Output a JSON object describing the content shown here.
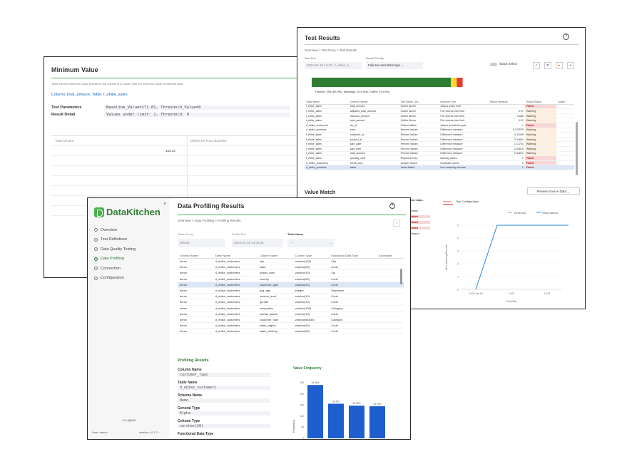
{
  "minimum_value": {
    "title": "Minimum Value",
    "description": "Tests that the minimum value present in the column is no lower than the minimum value in baseline data",
    "column_info": "Column: total_amount, Table: f_ebike_sales",
    "params_label": "Test Parameters",
    "params_value": "Baseline_Value=171.81, Threshold_Value=0",
    "result_label": "Result Detail",
    "result_value": "Values under limit: 1, Threshold: 0",
    "col1_header": "Total Amount",
    "col2_header": "Difference From Baseline",
    "cell_value": "153.13"
  },
  "test_results": {
    "title": "Test Results",
    "help": "?",
    "breadcrumb": "Overview > Test Runs > Test Results",
    "test_run_label": "Test Run",
    "test_run_value": "2024-01-15 14:10 - f_ebike_s...",
    "priority_label": "Result Priority",
    "priority_value": "Failures and Warnings",
    "stack_label": "Stack Select",
    "tools": [
      "✓",
      "✕",
      "▸",
      "+"
    ],
    "summary": "Passed: 209 (92.0%), Warnings: 9 (3.9%), Failed: 9 (3.9%)",
    "bar": {
      "passed_pct": 92.0,
      "warnings_pct": 3.9,
      "failed_pct": 3.9,
      "passed_color": "#2e7d32",
      "warning_color": "#fdd835",
      "failed_color": "#e53935"
    },
    "headers": [
      "Table Name",
      "Column Names",
      "Test Name / De...",
      "Measure Unit",
      "Result Measure",
      "Result Status",
      "Action"
    ],
    "rows": [
      [
        "f_ebike_sales",
        "total_amount",
        "Outlier Above",
        "Values under limit",
        "",
        "Failed",
        ""
      ],
      [
        "f_ebike_sales",
        "adjusted_total_amount",
        "Outlier Above",
        "Pct records over limit",
        "0.97",
        "Warning",
        ""
      ],
      [
        "f_ebike_sales",
        "discount_amount",
        "Outlier Above",
        "Pct records over limit",
        "0.886",
        "Warning",
        ""
      ],
      [
        "f_ebike_sales",
        "total_amount",
        "Outlier Above",
        "Pct records over limit",
        "0.97",
        "Warning",
        ""
      ],
      [
        "d_ebike_customers",
        "zip_id",
        "Pattern Match",
        "Values unmatched pat",
        "1",
        "Failed",
        ""
      ],
      [
        "d_ebike_products",
        "price",
        "Percent Values",
        "Difference measure",
        "0.123575",
        "Warning",
        ""
      ],
      [
        "f_ebike_sales",
        "customer_id",
        "Percent Values",
        "Difference measure",
        "0.11089",
        "Warning",
        ""
      ],
      [
        "f_ebike_sales",
        "product_id",
        "Percent Values",
        "Difference measure",
        "0.34844",
        "Warning",
        ""
      ],
      [
        "f_ebike_sales",
        "sale_date",
        "Percent Values",
        "Difference measure",
        "1.13743",
        "Warning",
        ""
      ],
      [
        "f_ebike_sales",
        "sale_time",
        "Percent Values",
        "Difference measure",
        "0.34816",
        "Warning",
        ""
      ],
      [
        "f_ebike_sales",
        "total_amount",
        "Percent Values",
        "Difference measure",
        "0.34871",
        "Warning",
        ""
      ],
      [
        "f_ebike_sales",
        "quantity_sold",
        "Required Entry",
        "Missing values",
        "1",
        "Failed",
        ""
      ],
      [
        "d_ebike_customers",
        "credit_card",
        "Unique Values",
        "Duplicate values",
        "0",
        "Failed",
        ""
      ],
      [
        "d_ebike_products",
        "sales",
        "Value Match",
        "Non-matching records",
        "1",
        "Failed",
        ""
      ]
    ],
    "selected_row": 13,
    "value_match_title": "Value Match",
    "review_button": "Review Source Data",
    "partial_text": "ource data...",
    "tab_history": "History",
    "tab_config": "Test Configuration",
    "mini_statuses": [
      "Status",
      "Failed",
      "Failed",
      "Failed",
      "Passed"
    ],
    "chart_data": {
      "type": "line",
      "series": [
        {
          "name": "Threshold",
          "color": "#90a4ae"
        },
        {
          "name": "Observations",
          "color": "#1e88e5"
        }
      ],
      "x": [
        "13:25 Jan 15",
        "14:00",
        "14:30"
      ],
      "y_ticks": [
        "0",
        "1",
        "2",
        "3",
        "4",
        "5"
      ],
      "points": [
        [
          0,
          0
        ],
        [
          0.6,
          5
        ],
        [
          2.6,
          5
        ]
      ],
      "ylabel": "Non-matching Records",
      "xlabel": "Test Date"
    }
  },
  "profiling": {
    "logo": "DataKitchen",
    "close": "×",
    "nav": [
      "Overview",
      "Test Definitions",
      "Data Quality Testing",
      "Data Profiling",
      "Connection",
      "Configuration"
    ],
    "nav_active": 3,
    "logout": "Logout",
    "user": "User: admin",
    "version": "version: v2.1.2 ~",
    "title": "Data Profiling Results",
    "help": "?",
    "breadcrumb": "Overview > Data Profiling > Profiling Results",
    "page_btn": "‹",
    "table_group_label": "Table Group",
    "table_group_value": "default",
    "profile_run_label": "Profile Run",
    "profile_run_value": "2024-01-15 14:09:32",
    "table_name_label": "Table Name",
    "table_name_value": "---",
    "headers": [
      "Schema Name",
      "Table Name",
      "Column Name",
      "Column Type",
      "Functional Data Type",
      "Anomalies"
    ],
    "rows": [
      [
        "demo",
        "d_ebike_customers",
        "city",
        "varchar(100)",
        "City",
        ""
      ],
      [
        "demo",
        "d_ebike_customers",
        "state",
        "varchar(50)",
        "Code",
        ""
      ],
      [
        "demo",
        "d_ebike_customers",
        "postal_code",
        "varchar(10)",
        "Zip",
        ""
      ],
      [
        "demo",
        "d_ebike_customers",
        "country",
        "varchar(50)",
        "Code",
        ""
      ],
      [
        "demo",
        "d_ebike_customers",
        "customer_type",
        "varchar(20)",
        "Code",
        ""
      ],
      [
        "demo",
        "d_ebike_customers",
        "avg_age",
        "integer",
        "Sequence",
        ""
      ],
      [
        "demo",
        "d_ebike_customers",
        "income_level",
        "varchar(10)",
        "Code",
        ""
      ],
      [
        "demo",
        "d_ebike_customers",
        "gender",
        "varchar(10)",
        "Code",
        ""
      ],
      [
        "demo",
        "d_ebike_customers",
        "occupation",
        "varchar(100)",
        "Category",
        ""
      ],
      [
        "demo",
        "d_ebike_customers",
        "marital_status",
        "varchar(10)",
        "Code",
        ""
      ],
      [
        "demo",
        "d_ebike_customers",
        "customer_note",
        "varchar(65535)",
        "Category",
        ""
      ],
      [
        "demo",
        "d_ebike_customers",
        "sales_region",
        "varchar(50)",
        "Code",
        ""
      ],
      [
        "demo",
        "d_ebike_customers",
        "sales_territory",
        "varchar(50)",
        "Code",
        ""
      ]
    ],
    "selected_row": 4,
    "profiling_results_title": "Profiling Results",
    "details": [
      {
        "label": "Column Name",
        "value": "customer_type"
      },
      {
        "label": "Table Name",
        "value": "d_ebike_customers"
      },
      {
        "label": "Schema Name",
        "value": "demo"
      },
      {
        "label": "General Type",
        "value": "Alpha"
      },
      {
        "label": "Column Type",
        "value": "varchar(20)"
      },
      {
        "label": "Functional Data Type",
        "value": ""
      }
    ],
    "value_frequency_title": "Value Frequency",
    "chart_data": {
      "type": "bar",
      "values": [
        38.36,
        24.9,
        23.53,
        23.13
      ],
      "labels": [
        "38.36%",
        "24.9%",
        "23.53%",
        "23.13%"
      ],
      "y_ticks": [
        "0",
        "50",
        "100",
        "150",
        "200",
        "250"
      ],
      "ylabel": "Frequency",
      "color": "#1e5ecf"
    }
  }
}
